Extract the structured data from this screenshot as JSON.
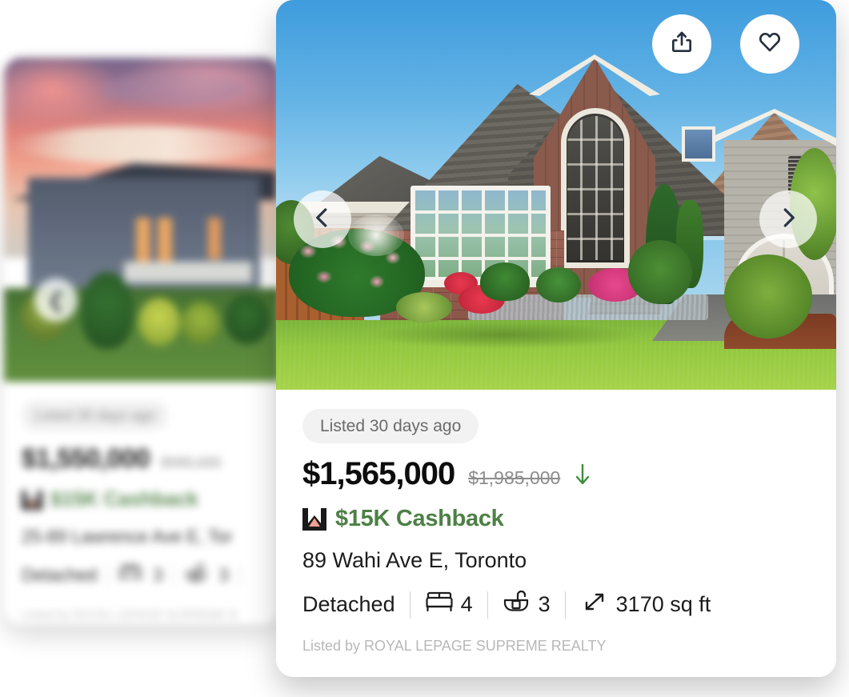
{
  "brand": {
    "accent_green": "#4d8045",
    "logo_roof": "#f0a192",
    "logo_dark": "#1a1a1a"
  },
  "front_card": {
    "photo": {
      "alt": "two-storey detached brick and siding house with manicured lawn",
      "controls": {
        "share_icon": "share-icon",
        "favorite_icon": "heart-icon",
        "prev_icon": "chevron-left-icon",
        "next_icon": "chevron-right-icon"
      }
    },
    "listed_badge": "Listed 30 days ago",
    "price": "$1,565,000",
    "old_price": "$1,985,000",
    "price_trend_icon": "arrow-down-icon",
    "cashback": "$15K Cashback",
    "cashback_logo_icon": "wahi-logo-icon",
    "address": "89 Wahi Ave E, Toronto",
    "specs": [
      {
        "icon": "home-type-icon",
        "label": "Detached",
        "value": ""
      },
      {
        "icon": "bed-icon",
        "label": "",
        "value": "4"
      },
      {
        "icon": "bath-icon",
        "label": "",
        "value": "3"
      },
      {
        "icon": "area-icon",
        "label": "",
        "value": "3170 sq ft"
      }
    ],
    "property_type": "Detached",
    "beds": "4",
    "baths": "3",
    "area": "3170 sq ft",
    "listed_by": "Listed by ROYAL LEPAGE SUPREME REALTY"
  },
  "back_card": {
    "photo": {
      "alt": "modern bungalow at sunset with pink sky, blurred"
    },
    "listed_badge": "Listed 30 days ago",
    "price": "$1,550,000",
    "old_price": "$985,000",
    "cashback": "$15K Cashback",
    "address": "25-89 Lawrence Ave E, Tor",
    "property_type": "Detached",
    "beds": "3",
    "baths": "3",
    "listed_by": "Listed by ROYAL LEPAGE SUPREME R"
  }
}
